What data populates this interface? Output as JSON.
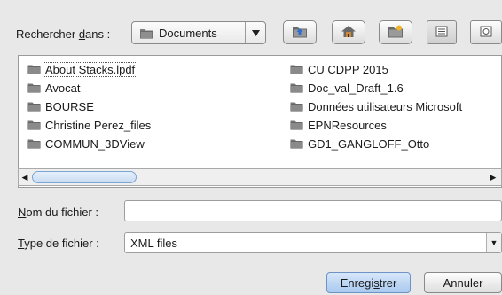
{
  "dialog": {
    "look_in": {
      "label_pre": "Rechercher ",
      "label_key": "d",
      "label_post": "ans :",
      "selected": "Documents"
    },
    "toolbar": {
      "buttons": [
        {
          "name": "up-folder-icon"
        },
        {
          "name": "home-icon"
        },
        {
          "name": "new-folder-icon"
        },
        {
          "name": "list-view-icon"
        },
        {
          "name": "details-view-icon"
        }
      ]
    },
    "files": {
      "column1": [
        "About Stacks.lpdf",
        "Avocat",
        "BOURSE",
        "Christine Perez_files",
        "COMMUN_3DView"
      ],
      "column2": [
        "CU CDPP 2015",
        "Doc_val_Draft_1.6",
        "Données utilisateurs Microsoft",
        "EPNResources",
        "GD1_GANGLOFF_Otto"
      ]
    },
    "filename": {
      "label_key": "N",
      "label_rest": "om du fichier :",
      "value": ""
    },
    "filetype": {
      "label_key": "T",
      "label_rest": "ype de fichier :",
      "selected": "XML files"
    },
    "buttons": {
      "save_pre": "Enregi",
      "save_key": "s",
      "save_post": "trer",
      "cancel": "Annuler"
    },
    "colors": {
      "folder": "#6b7280",
      "accent": "#a9c9ef"
    }
  }
}
